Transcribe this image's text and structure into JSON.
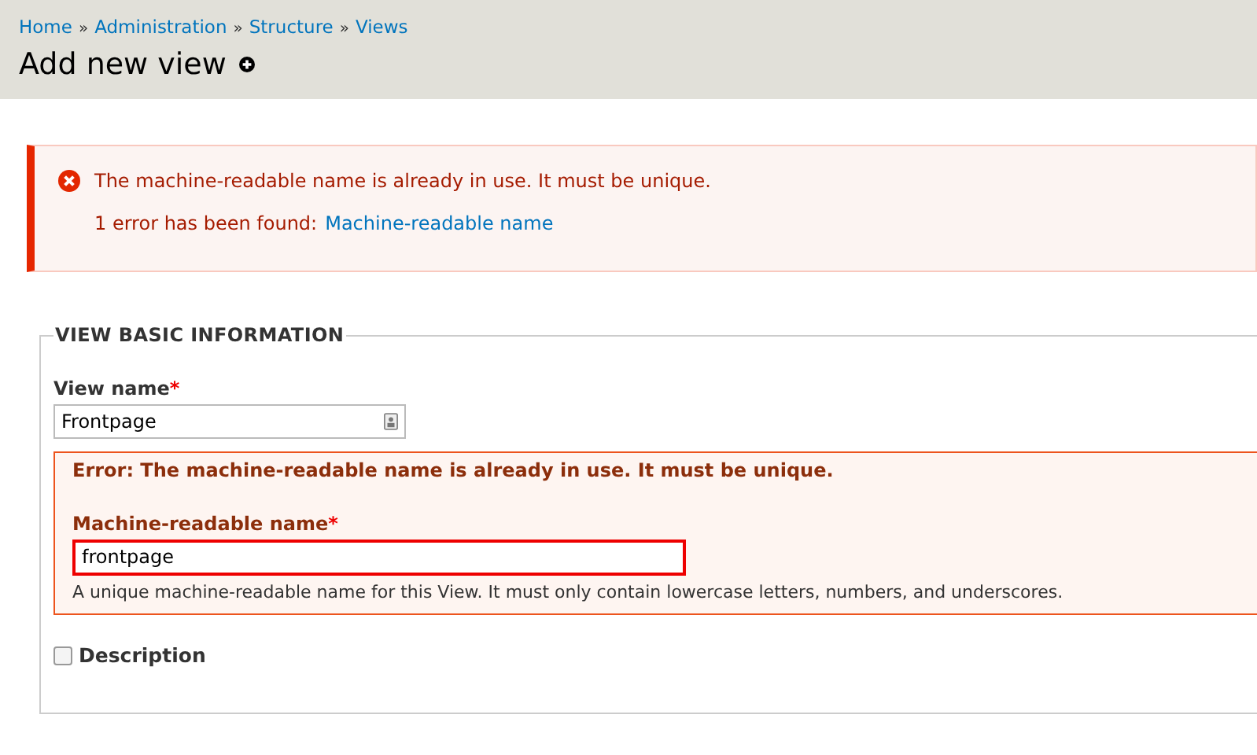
{
  "breadcrumbs": [
    "Home",
    "Administration",
    "Structure",
    "Views"
  ],
  "breadcrumb_separator": "»",
  "page_title": "Add new view",
  "messages": {
    "error": "The machine-readable name is already in use. It must be unique.",
    "summary": "1 error has been found:",
    "summary_link": "Machine-readable name"
  },
  "fieldset": {
    "legend": "VIEW BASIC INFORMATION",
    "view_name": {
      "label": "View name",
      "required_mark": "*",
      "value": "Frontpage"
    },
    "machine_name_error": {
      "message": "Error: The machine-readable name is already in use. It must be unique.",
      "label": "Machine-readable name",
      "required_mark": "*",
      "value": "frontpage",
      "invalid": true,
      "help": "A unique machine-readable name for this View. It must only contain lowercase letters, numbers, and underscores."
    },
    "description": {
      "label": "Description",
      "checked": false
    }
  }
}
